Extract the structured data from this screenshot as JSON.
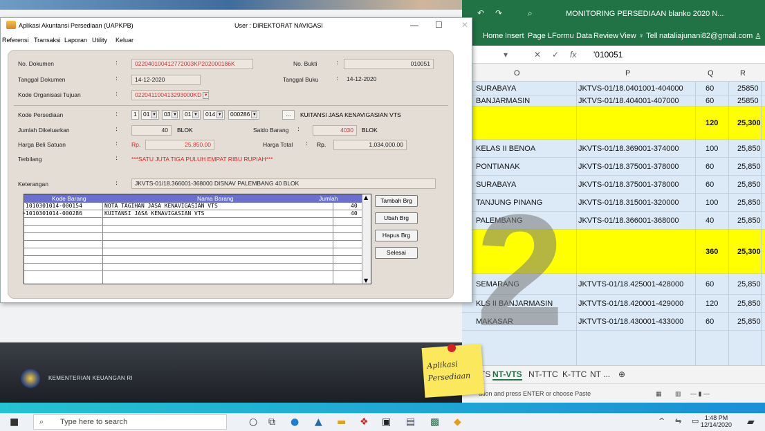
{
  "excel": {
    "title": "MONITORING PERSEDIAAN blanko 2020 N...",
    "ribbon_tabs": [
      "Home",
      "Insert",
      "Page L",
      "Formu",
      "Data",
      "Review",
      "View"
    ],
    "tell_me": "Tell",
    "account": "nataliajunani82@gmail.com",
    "formula_value": "'010051",
    "col_headers": [
      "O",
      "P",
      "Q",
      "R"
    ],
    "rows": [
      {
        "o": "SURABAYA",
        "p": "JKTVS-01/18.0401001-404000",
        "q": "60",
        "r": "25850",
        "yellow": false
      },
      {
        "o": "BANJARMASIN",
        "p": "JKTVS-01/18.404001-407000",
        "q": "60",
        "r": "25850",
        "yellow": false
      },
      {
        "o": "",
        "p": "",
        "q": "120",
        "r": "25,300",
        "yellow": true
      },
      {
        "o": "KELAS II BENOA",
        "p": "JKVTS-01/18.369001-374000",
        "q": "100",
        "r": "25,850",
        "yellow": false
      },
      {
        "o": "PONTIANAK",
        "p": "JKVTS-01/18.375001-378000",
        "q": "60",
        "r": "25,850",
        "yellow": false
      },
      {
        "o": "SURABAYA",
        "p": "JKVTS-01/18.375001-378000",
        "q": "60",
        "r": "25,850",
        "yellow": false
      },
      {
        "o": "TANJUNG PINANG",
        "p": "JKVTS-01/18.315001-320000",
        "q": "100",
        "r": "25,850",
        "yellow": false
      },
      {
        "o": "PALEMBANG",
        "p": "JKVTS-01/18.366001-368000",
        "q": "40",
        "r": "25,850",
        "yellow": false
      },
      {
        "o": "",
        "p": "",
        "q": "360",
        "r": "25,300",
        "yellow": true
      },
      {
        "o": "SEMARANG",
        "p": "JKTVTS-01/18.425001-428000",
        "q": "60",
        "r": "25,850",
        "yellow": false
      },
      {
        "o": "KLS II BANJARMASIN",
        "p": "JKTVTS-01/18.420001-429000",
        "q": "120",
        "r": "25,850",
        "yellow": false
      },
      {
        "o": "MAKASAR",
        "p": "JKTVTS-01/18.430001-433000",
        "q": "60",
        "r": "25,850",
        "yellow": false
      }
    ],
    "sheet_tabs": [
      "K-VTS",
      "NT-VTS",
      "NT-TTC",
      "K-TTC",
      "NT ..."
    ],
    "active_sheet": "NT-VTS",
    "status": "ation and press ENTER or choose Paste",
    "overlay_number": "2"
  },
  "app": {
    "title": "Aplikasi Akuntansi Persediaan (UAPKPB)",
    "user": "User : DIREKTORAT NAVIGASI",
    "menu": [
      "Referensi",
      "Transaksi",
      "Laporan",
      "Utility",
      "Keluar"
    ],
    "labels": {
      "no_dokumen": "No. Dokumen",
      "tanggal_dokumen": "Tanggal Dokumen",
      "kode_org": "Kode Organisasi Tujuan",
      "no_bukti": "No. Bukti",
      "tanggal_buku": "Tanggal Buku",
      "kode_persediaan": "Kode Persediaan",
      "jumlah_dikeluarkan": "Jumlah Dikeluarkan",
      "harga_beli": "Harga Beli Satuan",
      "terbilang": "Terbilang",
      "saldo_barang": "Saldo Barang",
      "harga_total": "Harga Total",
      "keterangan": "Keterangan"
    },
    "values": {
      "no_dokumen": "022040100412772003KP202000186K",
      "tanggal_dokumen": "14-12-2020",
      "kode_org": "022041100413293000KD",
      "no_bukti": "010051",
      "tanggal_buku": "14-12-2020",
      "kode_parts": [
        "1",
        "01",
        "03",
        "01",
        "014",
        "000286"
      ],
      "kode_desc": "KUITANSI JASA KENAVIGASIAN VTS",
      "jumlah": "40",
      "unit": "BLOK",
      "saldo": "4030",
      "saldo_unit": "BLOK",
      "rp": "Rp.",
      "harga_beli": "25,850.00",
      "harga_total": "1,034,000.00",
      "terbilang": "***SATU JUTA TIGA PULUH EMPAT RIBU RUPIAH***",
      "keterangan": "JKVTS-01/18.366001-368000 DISNAV PALEMBANG 40 BLOK"
    },
    "grid": {
      "headers": [
        "Kode Barang",
        "Nama Barang",
        "Jumlah"
      ],
      "rows": [
        [
          "1010301014-000154",
          "NOTA TAGIHAN JASA KENAVIGASIAN VTS",
          "40"
        ],
        [
          "1010301014-000286",
          "KUITANSI JASA KENAVIGASIAN VTS",
          "40"
        ]
      ]
    },
    "buttons": [
      "Tambah Brg",
      "Ubah Brg",
      "Hapus Brg",
      "Selesai"
    ],
    "footer": "KEMENTERIAN KEUANGAN RI"
  },
  "sticky": [
    "Aplikasi",
    "Persediaan"
  ],
  "taskbar": {
    "search": "Type here to search",
    "time": "1:48 PM",
    "date": "12/14/2020"
  }
}
